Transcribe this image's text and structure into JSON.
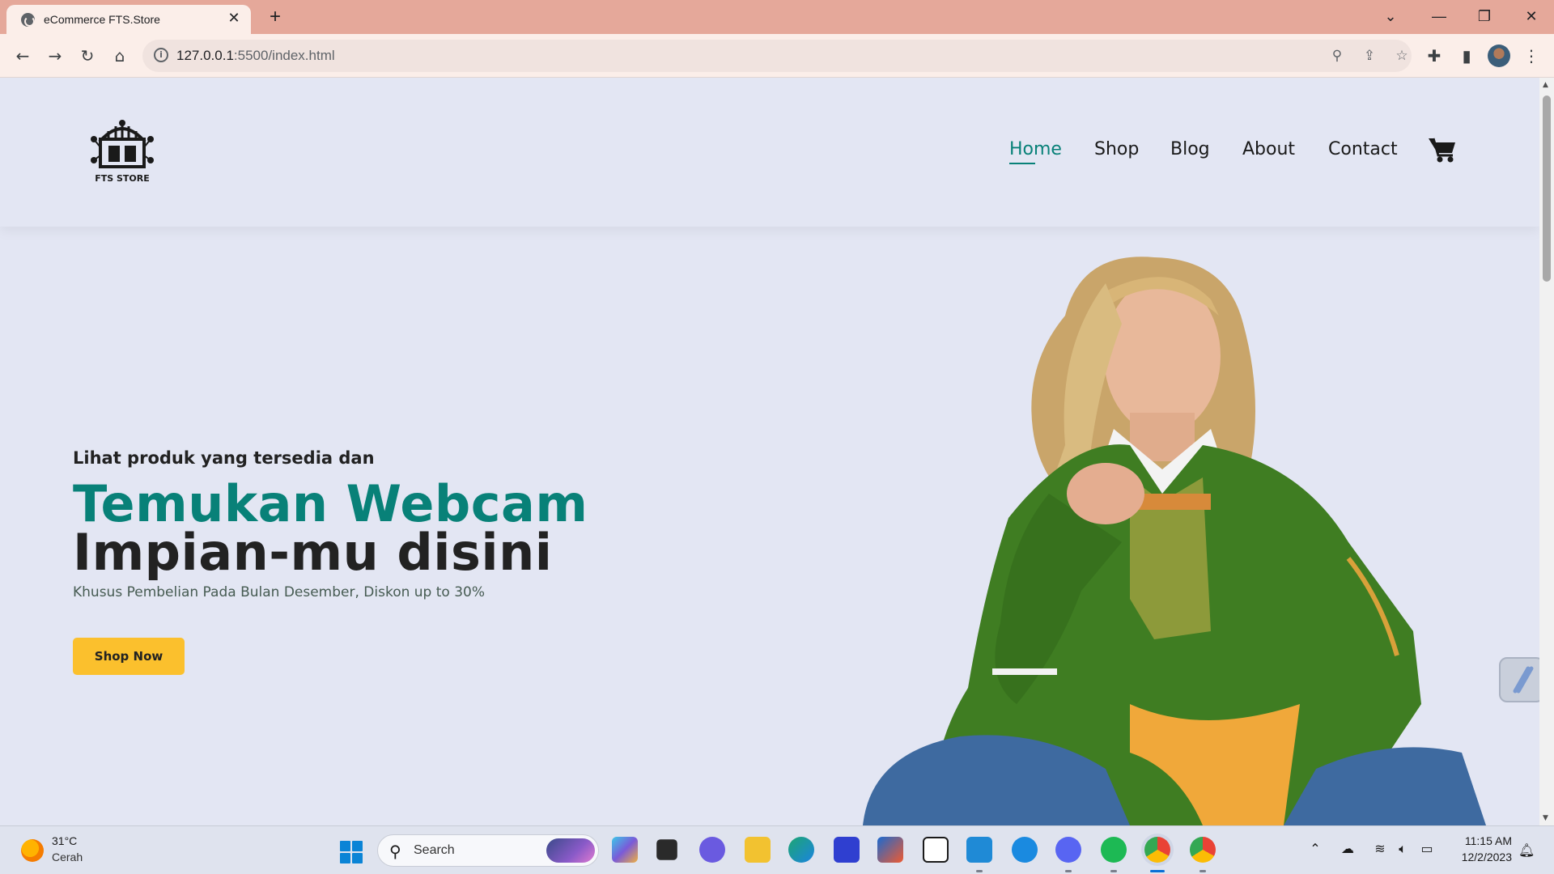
{
  "browser": {
    "tab_title": "eCommerce FTS.Store",
    "tab_close": "✕",
    "new_tab": "+",
    "url_host": "127.0.0.1",
    "url_rest": ":5500/index.html"
  },
  "site": {
    "logo_text": "FTS STORE",
    "nav": [
      "Home",
      "Shop",
      "Blog",
      "About",
      "Contact"
    ],
    "active_nav": "Home",
    "hero": {
      "subtitle": "Lihat produk yang tersedia dan",
      "heading_line1": "Temukan Webcam",
      "heading_line2": "Impian-mu disini",
      "description": "Khusus Pembelian Pada Bulan Desember, Diskon up to 30%",
      "button_label": "Shop Now"
    }
  },
  "taskbar": {
    "weather_temp": "31°C",
    "weather_desc": "Cerah",
    "search_label": "Search",
    "time": "11:15 AM",
    "date": "12/2/2023"
  },
  "colors": {
    "accent": "#088178",
    "button": "#fbc02d",
    "page_bg": "#e3e6f3",
    "tabstrip": "#e5a89a"
  }
}
